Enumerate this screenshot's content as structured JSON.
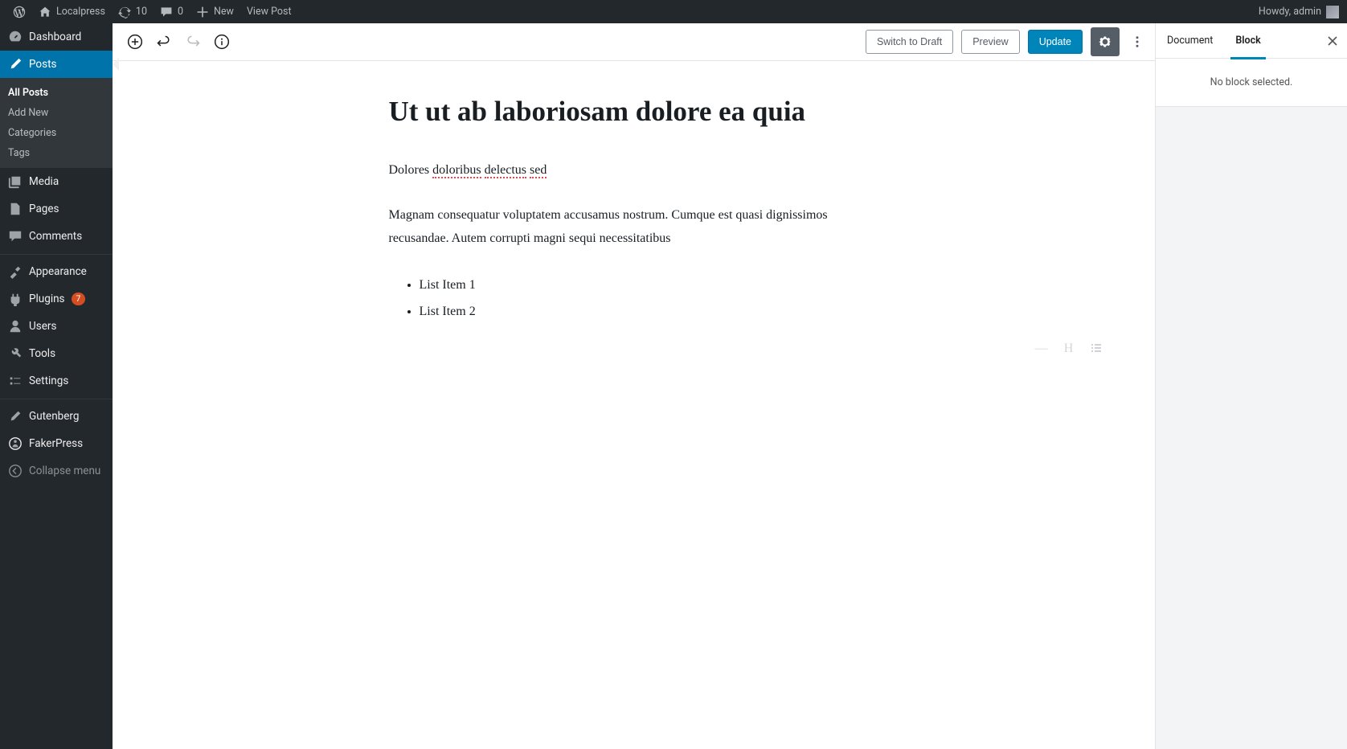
{
  "adminbar": {
    "site_name": "Localpress",
    "updates_count": "10",
    "comments_count": "0",
    "new_label": "New",
    "view_post": "View Post",
    "howdy": "Howdy, admin"
  },
  "sidebar": {
    "dashboard": "Dashboard",
    "posts": "Posts",
    "posts_sub": {
      "all": "All Posts",
      "add": "Add New",
      "categories": "Categories",
      "tags": "Tags"
    },
    "media": "Media",
    "pages": "Pages",
    "comments": "Comments",
    "appearance": "Appearance",
    "plugins": "Plugins",
    "plugins_badge": "7",
    "users": "Users",
    "tools": "Tools",
    "settings": "Settings",
    "gutenberg": "Gutenberg",
    "fakerpress": "FakerPress",
    "collapse": "Collapse menu"
  },
  "toolbar": {
    "switch_draft": "Switch to Draft",
    "preview": "Preview",
    "update": "Update"
  },
  "post": {
    "title": "Ut ut ab laboriosam dolore ea quia",
    "para1_pre": "Dolores ",
    "para1_w1": "doloribus",
    "para1_sp1": " ",
    "para1_w2": "delectus",
    "para1_sp2": " ",
    "para1_w3": "sed",
    "para2": "Magnam consequatur voluptatem accusamus nostrum. Cumque est quasi dignissimos recusandae. Autem corrupti magni sequi necessitatibus",
    "list": {
      "i1": "List Item 1",
      "i2": "List Item 2"
    }
  },
  "inserter": {
    "dash": "—",
    "h": "H",
    "list": "≡"
  },
  "rightpanel": {
    "tab_doc": "Document",
    "tab_block": "Block",
    "empty": "No block selected."
  }
}
